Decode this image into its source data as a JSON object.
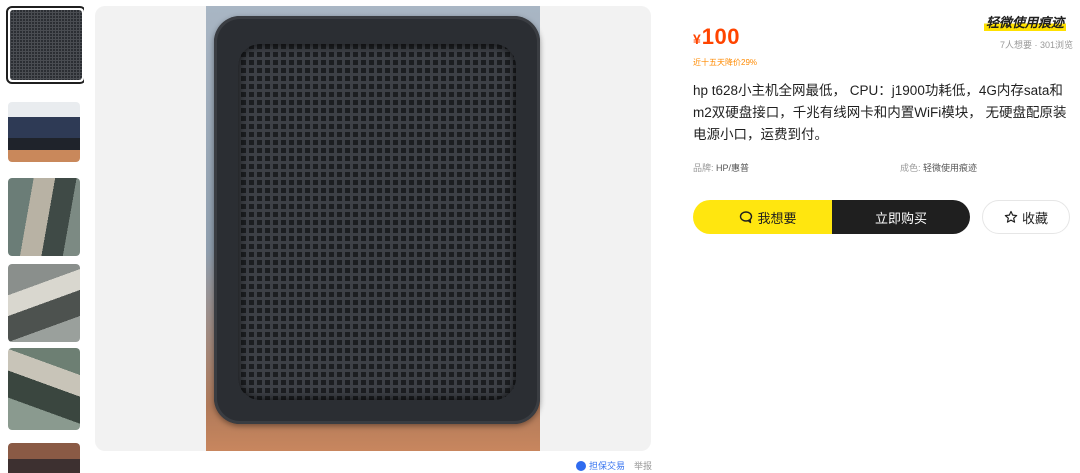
{
  "gallery": {
    "thumbnails": [
      {
        "name": "thumbnail-1",
        "colors": [
          "#2b2e33",
          "#4a4d52"
        ]
      },
      {
        "name": "thumbnail-2",
        "colors": [
          "#2e3a55",
          "#c9885b"
        ]
      },
      {
        "name": "thumbnail-3",
        "colors": [
          "#6b7d77",
          "#3f4a46"
        ]
      },
      {
        "name": "thumbnail-4",
        "colors": [
          "#8a8f8c",
          "#4d524f"
        ]
      },
      {
        "name": "thumbnail-5",
        "colors": [
          "#6d7f73",
          "#3a463f"
        ]
      },
      {
        "name": "thumbnail-6",
        "colors": [
          "#8a5a45",
          "#3d3030"
        ]
      }
    ]
  },
  "footer": {
    "guarantee_label": "担保交易",
    "report_label": "举报"
  },
  "product": {
    "condition_tag": "轻微使用痕迹",
    "currency": "¥",
    "price": "100",
    "stats": "7人想要 · 301浏览",
    "price_drop": "近十五天降价29%",
    "description": "hp t628小主机全网最低， CPU：j1900功耗低，4G内存sata和m2双硬盘接口，千兆有线网卡和内置WiFi模块， 无硬盘配原装电源小口，运费到付。",
    "attributes": {
      "brand_key": "品牌:",
      "brand_value": " HP/惠普",
      "condition_key": "成色:",
      "condition_value": " 轻微使用痕迹"
    }
  },
  "actions": {
    "want_label": "我想要",
    "buy_label": "立即购买",
    "fav_label": "收藏"
  },
  "colors": {
    "accent_yellow": "#ffe60f",
    "price_red": "#ff4400",
    "drop_orange": "#ff8a00",
    "guarantee_blue": "#3a76f0"
  }
}
